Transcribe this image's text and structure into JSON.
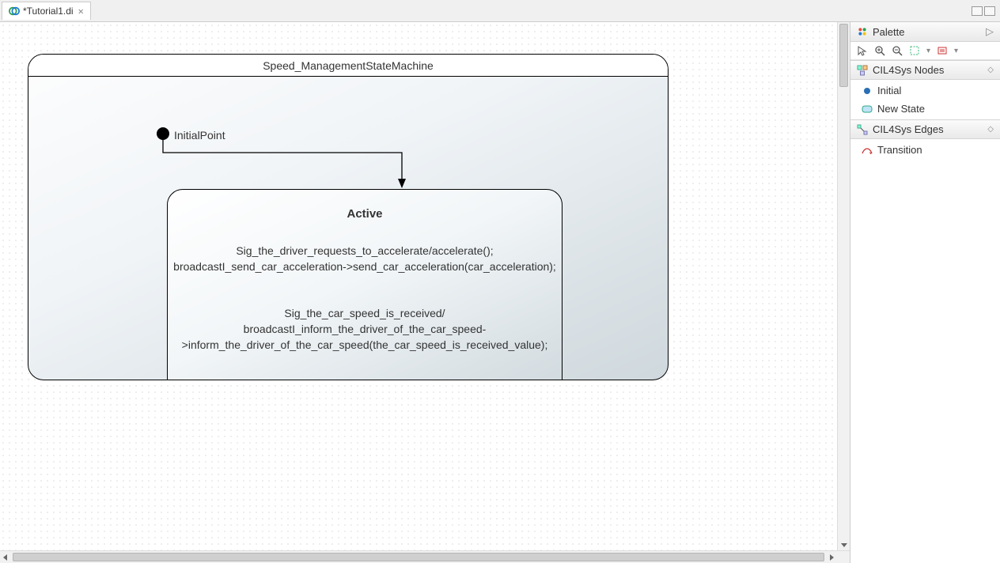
{
  "tab": {
    "title": "*Tutorial1.di"
  },
  "diagram": {
    "state_machine_title": "Speed_ManagementStateMachine",
    "initial_label": "InitialPoint",
    "state": {
      "name": "Active",
      "block1_line1": "Sig_the_driver_requests_to_accelerate/accelerate();",
      "block1_line2": "broadcastI_send_car_acceleration->send_car_acceleration(car_acceleration);",
      "block2_line1": "Sig_the_car_speed_is_received/",
      "block2_line2": "broadcastI_inform_the_driver_of_the_car_speed-",
      "block2_line3": ">inform_the_driver_of_the_car_speed(the_car_speed_is_received_value);"
    }
  },
  "palette": {
    "title": "Palette",
    "nodes_drawer": "CIL4Sys Nodes",
    "edges_drawer": "CIL4Sys Edges",
    "items": {
      "initial": "Initial",
      "new_state": "New State",
      "transition": "Transition"
    }
  }
}
